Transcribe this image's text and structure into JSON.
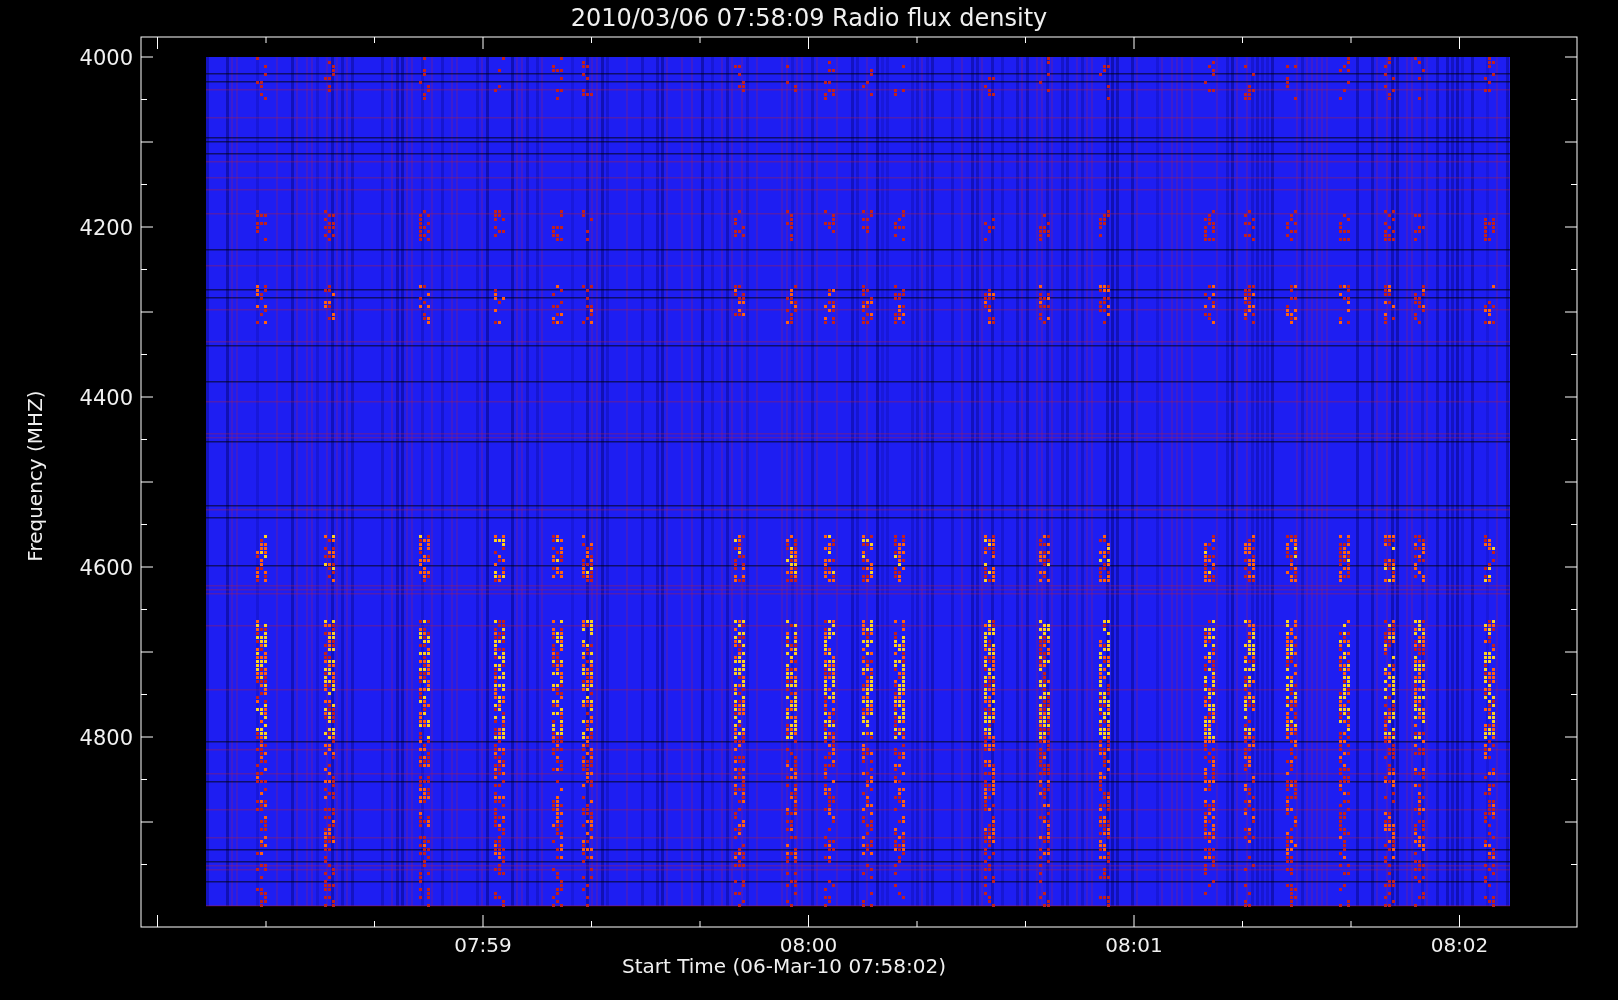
{
  "title": "2010/03/06 07:58:09 Radio flux density",
  "y_axis": {
    "label": "Frequency (MHZ)",
    "ticks": [
      "4000",
      "4200",
      "4400",
      "4600",
      "4800"
    ]
  },
  "x_axis": {
    "label": "Start Time (06-Mar-10 07:58:02)",
    "ticks": [
      "07:59",
      "08:00",
      "08:01",
      "08:02"
    ]
  }
}
